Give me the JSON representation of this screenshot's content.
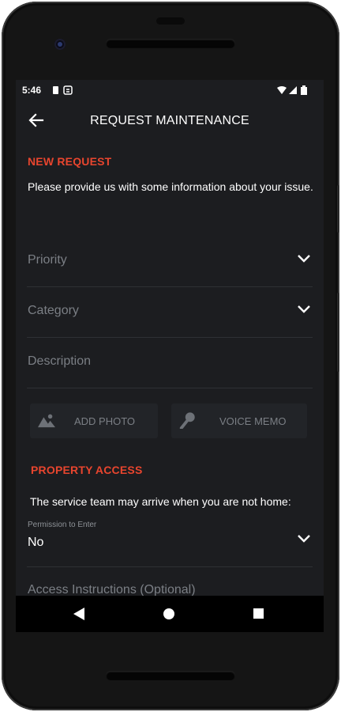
{
  "status": {
    "time": "5:46"
  },
  "appbar": {
    "title": "REQUEST MAINTENANCE"
  },
  "new_request": {
    "heading": "NEW REQUEST",
    "intro": "Please provide us with some information about your issue."
  },
  "fields": {
    "priority_placeholder": "Priority",
    "category_placeholder": "Category",
    "description_placeholder": "Description"
  },
  "media": {
    "add_photo": "ADD PHOTO",
    "voice_memo": "VOICE MEMO"
  },
  "property_access": {
    "heading": "PROPERTY ACCESS",
    "note": "The service team may arrive when you are not home:",
    "permission_label": "Permission to Enter",
    "permission_value": "No",
    "instructions_placeholder": "Access Instructions (Optional)"
  },
  "colors": {
    "accent": "#e8452e",
    "background": "#1c1d20",
    "muted_text": "#7b7f85"
  }
}
